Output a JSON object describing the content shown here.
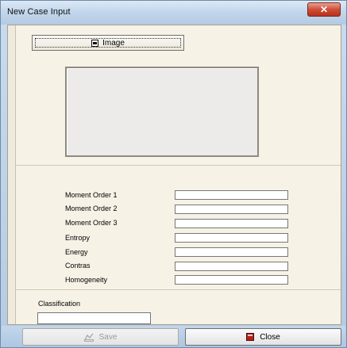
{
  "window": {
    "title": "New Case Input",
    "close_glyph": "✕"
  },
  "image_section": {
    "button_label": "Image",
    "button_icon": "image-icon"
  },
  "fields": [
    {
      "label": "Moment Order 1",
      "value": ""
    },
    {
      "label": "Moment Order 2",
      "value": ""
    },
    {
      "label": "Moment Order 3",
      "value": ""
    },
    {
      "label": "Entropy",
      "value": ""
    },
    {
      "label": "Energy",
      "value": ""
    },
    {
      "label": "Contras",
      "value": ""
    },
    {
      "label": "Homogeneity",
      "value": ""
    }
  ],
  "classification": {
    "label": "Classification",
    "value": ""
  },
  "footer": {
    "save_label": "Save",
    "save_enabled": false,
    "close_label": "Close"
  },
  "colors": {
    "client_bg": "#f7f2e6",
    "frame_blue": "#b4cbe3",
    "close_red": "#cf4d36"
  }
}
